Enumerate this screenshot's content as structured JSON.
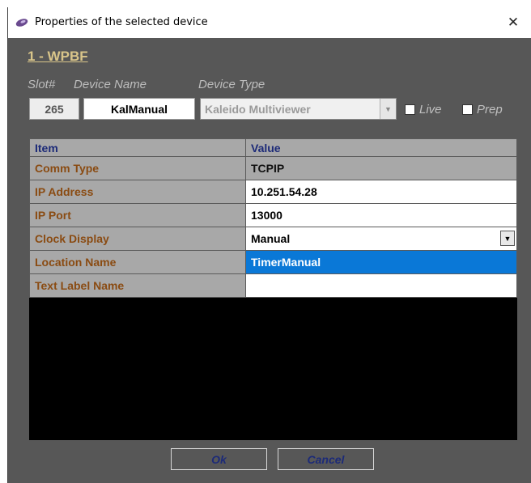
{
  "window": {
    "title": "Properties of the selected device",
    "close_glyph": "✕",
    "icon": "app-orb-icon"
  },
  "device": {
    "heading": "1 - WPBF",
    "slot_label": "Slot#",
    "name_label": "Device Name",
    "type_label": "Device Type",
    "slot_value": "265",
    "name_value": "KalManual",
    "type_value": "Kaleido Multiviewer",
    "live_label": "Live",
    "prep_label": "Prep",
    "live_checked": false,
    "prep_checked": false
  },
  "table": {
    "headers": [
      "Item",
      "Value"
    ],
    "rows": [
      {
        "item": "Comm Type",
        "value": "TCPIP"
      },
      {
        "item": "IP Address",
        "value": "10.251.54.28"
      },
      {
        "item": "IP Port",
        "value": "13000"
      },
      {
        "item": "Clock Display",
        "value": "Manual"
      },
      {
        "item": "Location Name",
        "value": "TimerManual"
      },
      {
        "item": "Text Label Name",
        "value": ""
      }
    ]
  },
  "buttons": {
    "ok": "Ok",
    "cancel": "Cancel"
  },
  "colors": {
    "dialog_bg": "#575757",
    "heading": "#d9c58a",
    "item_text": "#8a4b12",
    "header_text": "#1c2a78",
    "selection": "#0a78d7"
  }
}
